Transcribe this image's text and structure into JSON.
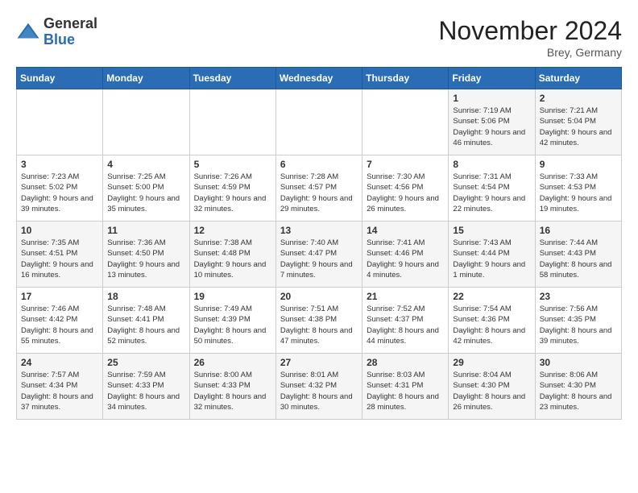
{
  "logo": {
    "general": "General",
    "blue": "Blue"
  },
  "title": "November 2024",
  "location": "Brey, Germany",
  "days_of_week": [
    "Sunday",
    "Monday",
    "Tuesday",
    "Wednesday",
    "Thursday",
    "Friday",
    "Saturday"
  ],
  "weeks": [
    [
      {
        "day": "",
        "info": ""
      },
      {
        "day": "",
        "info": ""
      },
      {
        "day": "",
        "info": ""
      },
      {
        "day": "",
        "info": ""
      },
      {
        "day": "",
        "info": ""
      },
      {
        "day": "1",
        "info": "Sunrise: 7:19 AM\nSunset: 5:06 PM\nDaylight: 9 hours and 46 minutes."
      },
      {
        "day": "2",
        "info": "Sunrise: 7:21 AM\nSunset: 5:04 PM\nDaylight: 9 hours and 42 minutes."
      }
    ],
    [
      {
        "day": "3",
        "info": "Sunrise: 7:23 AM\nSunset: 5:02 PM\nDaylight: 9 hours and 39 minutes."
      },
      {
        "day": "4",
        "info": "Sunrise: 7:25 AM\nSunset: 5:00 PM\nDaylight: 9 hours and 35 minutes."
      },
      {
        "day": "5",
        "info": "Sunrise: 7:26 AM\nSunset: 4:59 PM\nDaylight: 9 hours and 32 minutes."
      },
      {
        "day": "6",
        "info": "Sunrise: 7:28 AM\nSunset: 4:57 PM\nDaylight: 9 hours and 29 minutes."
      },
      {
        "day": "7",
        "info": "Sunrise: 7:30 AM\nSunset: 4:56 PM\nDaylight: 9 hours and 26 minutes."
      },
      {
        "day": "8",
        "info": "Sunrise: 7:31 AM\nSunset: 4:54 PM\nDaylight: 9 hours and 22 minutes."
      },
      {
        "day": "9",
        "info": "Sunrise: 7:33 AM\nSunset: 4:53 PM\nDaylight: 9 hours and 19 minutes."
      }
    ],
    [
      {
        "day": "10",
        "info": "Sunrise: 7:35 AM\nSunset: 4:51 PM\nDaylight: 9 hours and 16 minutes."
      },
      {
        "day": "11",
        "info": "Sunrise: 7:36 AM\nSunset: 4:50 PM\nDaylight: 9 hours and 13 minutes."
      },
      {
        "day": "12",
        "info": "Sunrise: 7:38 AM\nSunset: 4:48 PM\nDaylight: 9 hours and 10 minutes."
      },
      {
        "day": "13",
        "info": "Sunrise: 7:40 AM\nSunset: 4:47 PM\nDaylight: 9 hours and 7 minutes."
      },
      {
        "day": "14",
        "info": "Sunrise: 7:41 AM\nSunset: 4:46 PM\nDaylight: 9 hours and 4 minutes."
      },
      {
        "day": "15",
        "info": "Sunrise: 7:43 AM\nSunset: 4:44 PM\nDaylight: 9 hours and 1 minute."
      },
      {
        "day": "16",
        "info": "Sunrise: 7:44 AM\nSunset: 4:43 PM\nDaylight: 8 hours and 58 minutes."
      }
    ],
    [
      {
        "day": "17",
        "info": "Sunrise: 7:46 AM\nSunset: 4:42 PM\nDaylight: 8 hours and 55 minutes."
      },
      {
        "day": "18",
        "info": "Sunrise: 7:48 AM\nSunset: 4:41 PM\nDaylight: 8 hours and 52 minutes."
      },
      {
        "day": "19",
        "info": "Sunrise: 7:49 AM\nSunset: 4:39 PM\nDaylight: 8 hours and 50 minutes."
      },
      {
        "day": "20",
        "info": "Sunrise: 7:51 AM\nSunset: 4:38 PM\nDaylight: 8 hours and 47 minutes."
      },
      {
        "day": "21",
        "info": "Sunrise: 7:52 AM\nSunset: 4:37 PM\nDaylight: 8 hours and 44 minutes."
      },
      {
        "day": "22",
        "info": "Sunrise: 7:54 AM\nSunset: 4:36 PM\nDaylight: 8 hours and 42 minutes."
      },
      {
        "day": "23",
        "info": "Sunrise: 7:56 AM\nSunset: 4:35 PM\nDaylight: 8 hours and 39 minutes."
      }
    ],
    [
      {
        "day": "24",
        "info": "Sunrise: 7:57 AM\nSunset: 4:34 PM\nDaylight: 8 hours and 37 minutes."
      },
      {
        "day": "25",
        "info": "Sunrise: 7:59 AM\nSunset: 4:33 PM\nDaylight: 8 hours and 34 minutes."
      },
      {
        "day": "26",
        "info": "Sunrise: 8:00 AM\nSunset: 4:33 PM\nDaylight: 8 hours and 32 minutes."
      },
      {
        "day": "27",
        "info": "Sunrise: 8:01 AM\nSunset: 4:32 PM\nDaylight: 8 hours and 30 minutes."
      },
      {
        "day": "28",
        "info": "Sunrise: 8:03 AM\nSunset: 4:31 PM\nDaylight: 8 hours and 28 minutes."
      },
      {
        "day": "29",
        "info": "Sunrise: 8:04 AM\nSunset: 4:30 PM\nDaylight: 8 hours and 26 minutes."
      },
      {
        "day": "30",
        "info": "Sunrise: 8:06 AM\nSunset: 4:30 PM\nDaylight: 8 hours and 23 minutes."
      }
    ]
  ]
}
